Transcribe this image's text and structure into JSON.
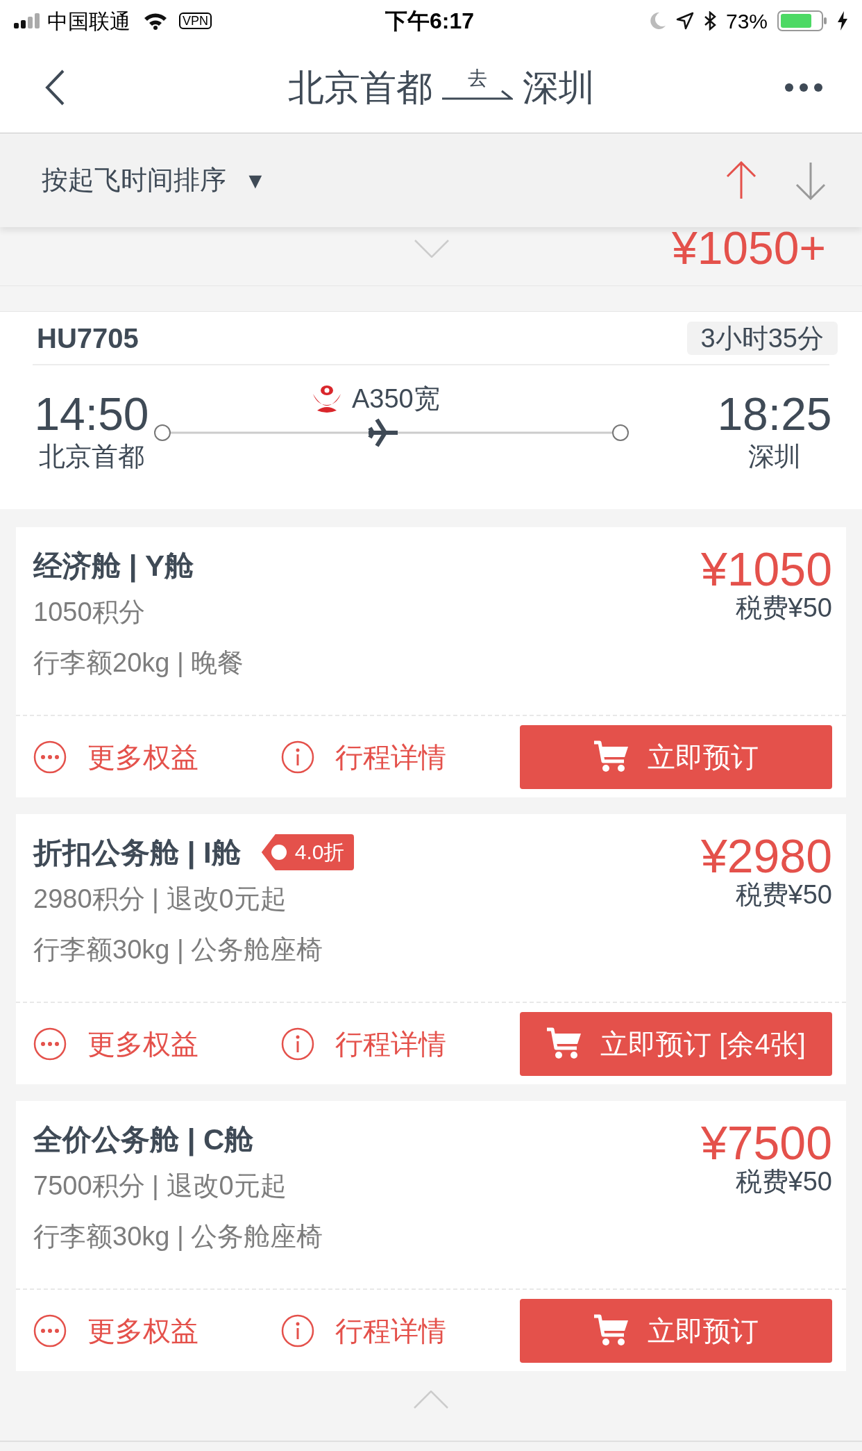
{
  "status_bar": {
    "carrier": "中国联通",
    "vpn": "VPN",
    "time": "下午6:17",
    "battery": "73%"
  },
  "nav": {
    "from": "北京首都",
    "via": "去",
    "to": "深圳"
  },
  "sort_bar": {
    "label": "按起飞时间排序",
    "caret": "▼",
    "directions": [
      {
        "kind": "up",
        "selected": true
      },
      {
        "kind": "down",
        "selected": false
      }
    ]
  },
  "collapsed_row": {
    "price": "¥1050+"
  },
  "flight": {
    "number": "HU7705",
    "duration": "3小时35分",
    "aircraft": "A350宽",
    "departure": {
      "time": "14:50",
      "airport": "北京首都"
    },
    "arrival": {
      "time": "18:25",
      "airport": "深圳"
    }
  },
  "fares": [
    {
      "title": "经济舱 | Y舱",
      "price": "¥1050",
      "tax": "税费¥50",
      "details": [
        "1050积分",
        "行李额20kg | 晚餐"
      ],
      "actions": [
        "更多权益",
        "行程详情"
      ],
      "book": "立即预订"
    },
    {
      "title": "折扣公务舱 | I舱",
      "tag": "4.0折",
      "price": "¥2980",
      "tax": "税费¥50",
      "details": [
        "2980积分 | 退改0元起",
        "行李额30kg | 公务舱座椅"
      ],
      "actions": [
        "更多权益",
        "行程详情"
      ],
      "book": "立即预订 [余4张]"
    },
    {
      "title": "全价公务舱 | C舱",
      "price": "¥7500",
      "tax": "税费¥50",
      "details": [
        "7500积分 | 退改0元起",
        "行李额30kg | 公务舱座椅"
      ],
      "actions": [
        "更多权益",
        "行程详情"
      ],
      "book": "立即预订"
    }
  ]
}
